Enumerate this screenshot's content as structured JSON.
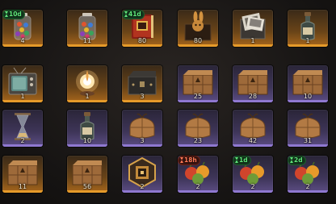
{
  "colors": {
    "rarity_orange": "#e59a2a",
    "rarity_purple": "#8f78d0",
    "timer_green": "#5fe67a",
    "timer_red": "#ff7a56"
  },
  "items": [
    {
      "name": "candy-jar-icon",
      "quantity": "4",
      "rarity": "orange",
      "timer": "10d",
      "timer_color": "green"
    },
    {
      "name": "candy-jar-icon",
      "quantity": "11",
      "rarity": "orange",
      "timer": "",
      "timer_color": ""
    },
    {
      "name": "book-tome-icon",
      "quantity": "80",
      "rarity": "orange",
      "timer": "41d",
      "timer_color": "green"
    },
    {
      "name": "rabbit-figure-box-icon",
      "quantity": "80",
      "rarity": "orange",
      "timer": "",
      "timer_color": ""
    },
    {
      "name": "photo-box-icon",
      "quantity": "1",
      "rarity": "orange",
      "timer": "",
      "timer_color": ""
    },
    {
      "name": "bottle-icon",
      "quantity": "1",
      "rarity": "orange",
      "timer": "",
      "timer_color": ""
    },
    {
      "name": "old-tv-icon",
      "quantity": "1",
      "rarity": "orange",
      "timer": "",
      "timer_color": ""
    },
    {
      "name": "magic-orb-icon",
      "quantity": "1",
      "rarity": "orange",
      "timer": "",
      "timer_color": ""
    },
    {
      "name": "dark-chest-icon",
      "quantity": "3",
      "rarity": "orange",
      "timer": "",
      "timer_color": ""
    },
    {
      "name": "wooden-crate-icon",
      "quantity": "25",
      "rarity": "purple",
      "timer": "",
      "timer_color": ""
    },
    {
      "name": "wooden-crate-icon",
      "quantity": "28",
      "rarity": "purple",
      "timer": "",
      "timer_color": ""
    },
    {
      "name": "wooden-crate-icon",
      "quantity": "10",
      "rarity": "purple",
      "timer": "",
      "timer_color": ""
    },
    {
      "name": "hourglass-icon",
      "quantity": "2",
      "rarity": "purple",
      "timer": "",
      "timer_color": ""
    },
    {
      "name": "bottle-icon",
      "quantity": "10",
      "rarity": "purple",
      "timer": "",
      "timer_color": ""
    },
    {
      "name": "tied-sack-icon",
      "quantity": "3",
      "rarity": "purple",
      "timer": "",
      "timer_color": ""
    },
    {
      "name": "tied-sack-icon",
      "quantity": "23",
      "rarity": "purple",
      "timer": "",
      "timer_color": ""
    },
    {
      "name": "tied-sack-icon",
      "quantity": "42",
      "rarity": "purple",
      "timer": "",
      "timer_color": ""
    },
    {
      "name": "tied-sack-icon",
      "quantity": "31",
      "rarity": "purple",
      "timer": "",
      "timer_color": ""
    },
    {
      "name": "wooden-crate-icon",
      "quantity": "11",
      "rarity": "orange",
      "timer": "",
      "timer_color": ""
    },
    {
      "name": "wooden-crate-icon",
      "quantity": "56",
      "rarity": "orange",
      "timer": "",
      "timer_color": ""
    },
    {
      "name": "gold-emblem-icon",
      "quantity": "2",
      "rarity": "purple",
      "timer": "",
      "timer_color": ""
    },
    {
      "name": "fruit-bundle-icon",
      "quantity": "2",
      "rarity": "purple",
      "timer": "18h",
      "timer_color": "red"
    },
    {
      "name": "fruit-bundle-icon",
      "quantity": "2",
      "rarity": "purple",
      "timer": "1d",
      "timer_color": "green"
    },
    {
      "name": "fruit-bundle-icon",
      "quantity": "2",
      "rarity": "purple",
      "timer": "2d",
      "timer_color": "green"
    }
  ]
}
